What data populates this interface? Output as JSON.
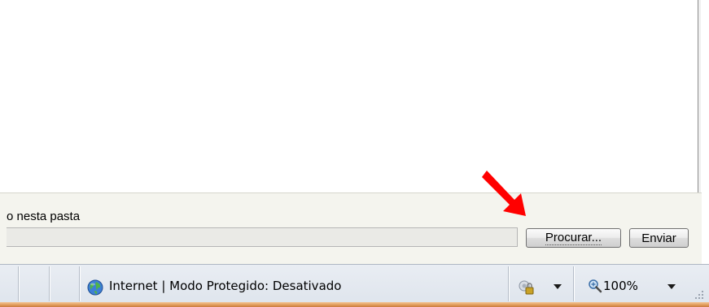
{
  "upload": {
    "label": "o nesta pasta",
    "path_value": "",
    "browse_label": "Procurar...",
    "send_label": "Enviar"
  },
  "annotation": {
    "arrow_color": "#ff0000"
  },
  "statusbar": {
    "zone_text": "Internet | Modo Protegido: Desativado",
    "zone_icon": "globe-icon",
    "security_icon": "lock-settings-icon",
    "zoom_icon": "magnifier-icon",
    "zoom_level": "100%"
  },
  "colors": {
    "panel_bg": "#f4f4ee",
    "statusbar_bg": "#e4e9f0",
    "taskbar_accent": "#e09a58"
  }
}
